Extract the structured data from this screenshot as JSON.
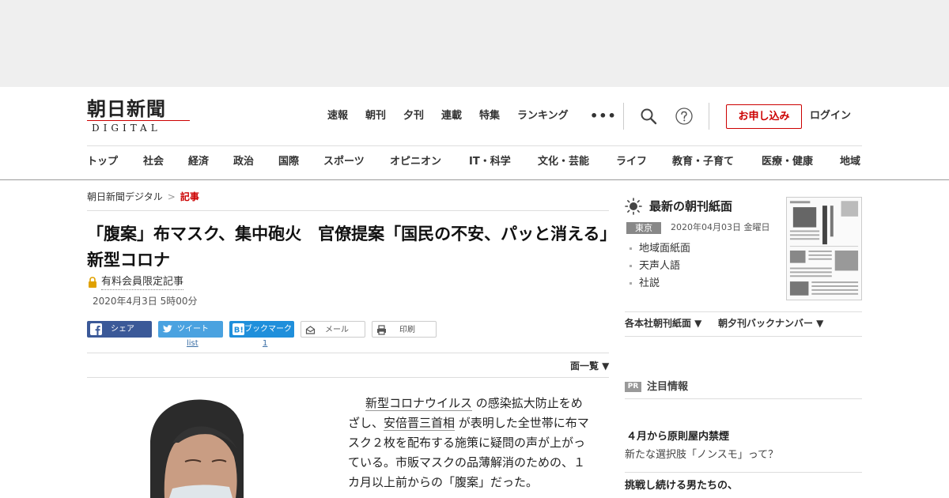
{
  "logo": {
    "main": "朝日新聞",
    "sub": "DIGITAL"
  },
  "topnav": [
    "速報",
    "朝刊",
    "夕刊",
    "連載",
    "特集",
    "ランキング"
  ],
  "more_label": "•••",
  "header": {
    "apply_label": "お申し込み",
    "login_label": "ログイン"
  },
  "categories": [
    "トップ",
    "社会",
    "経済",
    "政治",
    "国際",
    "スポーツ",
    "オピニオン",
    "IT・科学",
    "文化・芸能",
    "ライフ",
    "教育・子育て",
    "医療・健康",
    "地域"
  ],
  "breadcrumb": {
    "home": "朝日新聞デジタル",
    "sep": ">",
    "current": "記事"
  },
  "article": {
    "title": "「腹案」布マスク、集中砲火　官僚提案「国民の不安、パッと消える」　新型コロナ",
    "members_label": "有料会員限定記事",
    "date": "2020年4月3日 5時00分",
    "page_list": "面一覧 ▼",
    "body": {
      "p1": "新型コロナウイルス",
      "p2": " の感染拡大防止をめざし、",
      "p3": "安倍晋三首相",
      "p4": " が表明した全世帯に布マスク２枚を配布する施策に疑問の声が上がっている。市販マスクの品薄解消のための、１カ月以上前からの「腹案」だった。"
    }
  },
  "share": {
    "facebook": "シェア",
    "twitter": "ツイート",
    "twitter_count": "list",
    "hatena": "ブックマーク",
    "hatena_count": "1",
    "mail": "メール",
    "print": "印刷"
  },
  "sidebar": {
    "title": "最新の朝刊紙面",
    "edition": "東京",
    "date": "2020年04月03日 金曜日",
    "links": [
      "地域面紙面",
      "天声人語",
      "社説"
    ],
    "dropdown1": "各本社朝刊紙面 ▼",
    "dropdown2": "朝夕刊バックナンバー ▼",
    "pr_badge": "PR",
    "pr_label": "注目情報",
    "pr1_title": "４月から原則屋内禁煙",
    "pr1_desc": "新たな選択肢「ノンスモ」って？",
    "pr2_title": "挑戦し続ける男たちの、"
  },
  "colors": {
    "accent": "#cc0000",
    "facebook": "#3b5998",
    "twitter": "#4aa2e0",
    "hatena": "#1f8fdb"
  }
}
